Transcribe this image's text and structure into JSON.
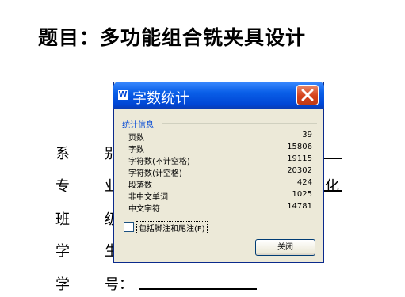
{
  "document": {
    "title": "题目：多功能组合铣夹具设计",
    "fields": [
      {
        "label": "系",
        "value": "别"
      },
      {
        "label": "专",
        "value": "业"
      },
      {
        "label": "班",
        "value": "级"
      },
      {
        "label": "学",
        "value": "生"
      },
      {
        "label": "学",
        "value": "号："
      }
    ],
    "right_edge_char": "化"
  },
  "dialog": {
    "icon": "W",
    "title": "字数统计",
    "close_icon": "close-x-icon",
    "group_caption": "统计信息",
    "stats": [
      {
        "name": "页数",
        "value": "39"
      },
      {
        "name": "字数",
        "value": "15806"
      },
      {
        "name": "字符数(不计空格)",
        "value": "19115"
      },
      {
        "name": "字符数(计空格)",
        "value": "20302"
      },
      {
        "name": "段落数",
        "value": "424"
      },
      {
        "name": "非中文单词",
        "value": "1025"
      },
      {
        "name": "中文字符",
        "value": "14781"
      }
    ],
    "include_footnotes_label": "包括脚注和尾注(F)",
    "include_footnotes_checked": false,
    "close_button_label": "关闭"
  }
}
